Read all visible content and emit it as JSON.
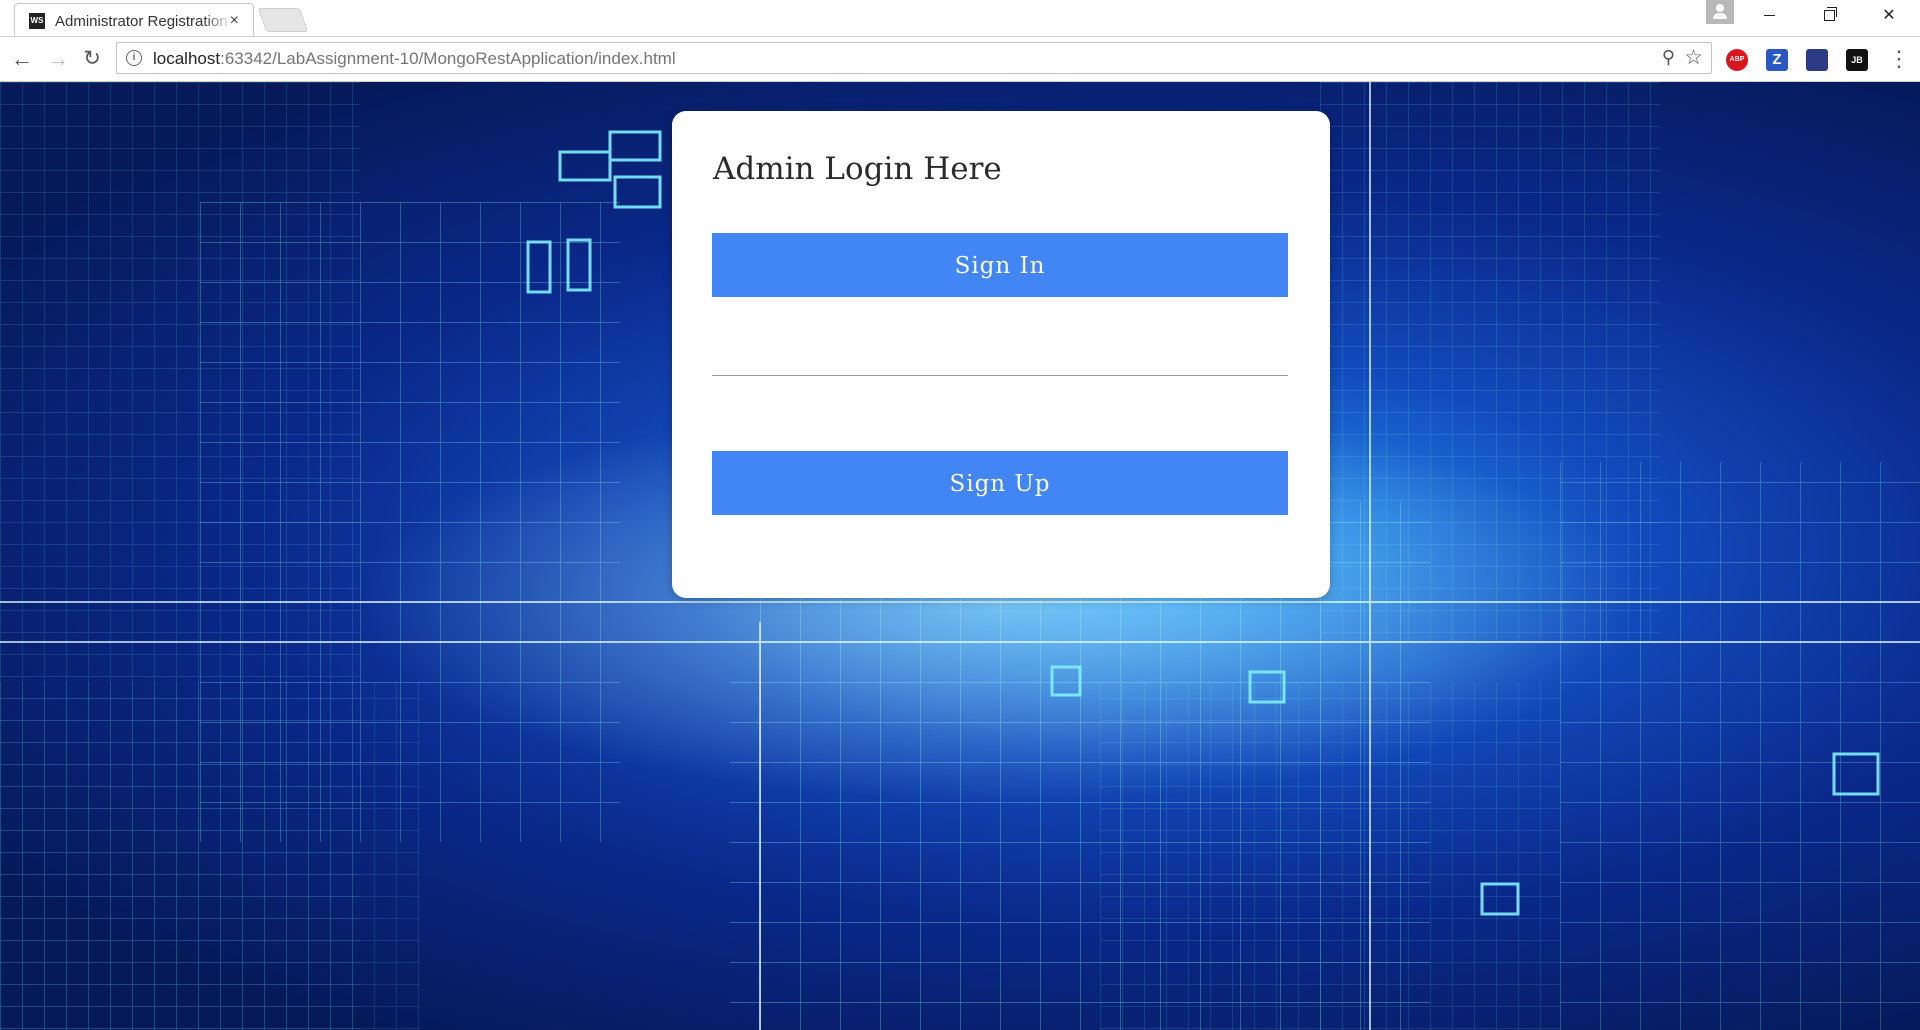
{
  "browser": {
    "tab": {
      "favicon": "WS",
      "title": "Administrator Registration",
      "close": "×"
    },
    "nav": {
      "back": "←",
      "forward": "→",
      "reload": "↻"
    },
    "address": {
      "host": "localhost",
      "path": ":63342/LabAssignment-10/MongoRestApplication/index.html",
      "info_icon": "i",
      "zoom_icon": "⚲",
      "star_icon": "☆"
    },
    "extensions": {
      "abp": "ABP",
      "z": "Z",
      "cs": "",
      "jb": "JB"
    },
    "menu": "⋮",
    "window": {
      "close": "✕"
    }
  },
  "page": {
    "title": "Admin Login Here",
    "signin_label": "Sign In",
    "signup_label": "Sign Up"
  }
}
